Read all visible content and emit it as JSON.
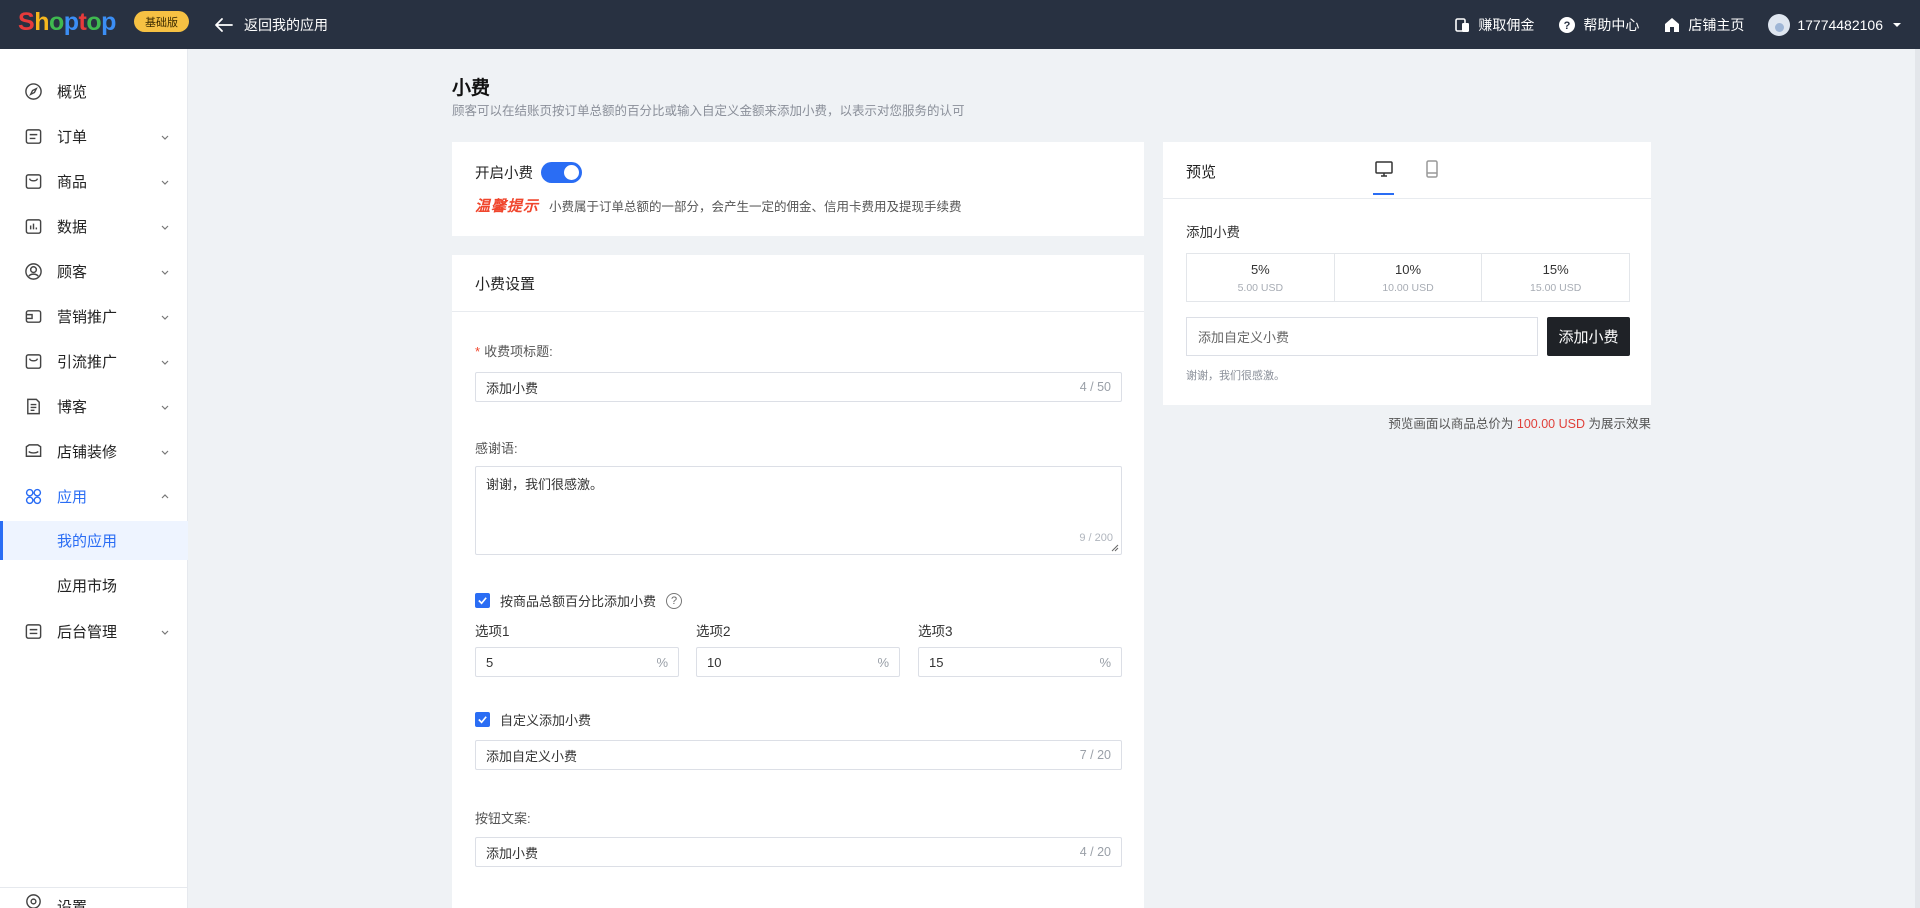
{
  "topbar": {
    "logo_letters": [
      "S",
      "h",
      "o",
      "p",
      "t",
      "o",
      "p"
    ],
    "plan_badge": "基础版",
    "back_label": "返回我的应用",
    "earn_label": "赚取佣金",
    "help_label": "帮助中心",
    "store_label": "店铺主页",
    "account_label": "17774482106"
  },
  "sidebar": {
    "items": [
      {
        "label": "概览",
        "icon": "compass-icon"
      },
      {
        "label": "订单",
        "icon": "order-icon"
      },
      {
        "label": "商品",
        "icon": "bag-icon"
      },
      {
        "label": "数据",
        "icon": "chart-icon"
      },
      {
        "label": "顾客",
        "icon": "user-icon"
      },
      {
        "label": "营销推广",
        "icon": "megaphone-icon"
      },
      {
        "label": "引流推广",
        "icon": "traffic-icon"
      },
      {
        "label": "博客",
        "icon": "blog-icon"
      },
      {
        "label": "店铺装修",
        "icon": "decor-icon"
      },
      {
        "label": "应用",
        "icon": "apps-icon"
      },
      {
        "label": "后台管理",
        "icon": "admin-icon"
      }
    ],
    "sub_items": [
      {
        "label": "我的应用"
      },
      {
        "label": "应用市场"
      }
    ],
    "bottom_label": "设置"
  },
  "page": {
    "title": "小费",
    "description": "顾客可以在结账页按订单总额的百分比或输入自定义金额来添加小费，以表示对您服务的认可"
  },
  "toggle_card": {
    "label": "开启小费",
    "enabled": true,
    "tip_label": "温馨提示",
    "tip_text": "小费属于订单总额的一部分，会产生一定的佣金、信用卡费用及提现手续费"
  },
  "settings": {
    "header": "小费设置",
    "title_field": {
      "label": "收费项标题:",
      "value": "添加小费",
      "counter": "4 / 50"
    },
    "thanks_field": {
      "label": "感谢语:",
      "value": "谢谢，我们很感激。",
      "counter": "9 / 200"
    },
    "percent_check": {
      "label": "按商品总额百分比添加小费",
      "checked": true,
      "help": "?"
    },
    "options": [
      {
        "label": "选项1",
        "value": "5",
        "suffix": "%"
      },
      {
        "label": "选项2",
        "value": "10",
        "suffix": "%"
      },
      {
        "label": "选项3",
        "value": "15",
        "suffix": "%"
      }
    ],
    "custom_check": {
      "label": "自定义添加小费",
      "checked": true
    },
    "custom_field": {
      "value": "添加自定义小费",
      "counter": "7 / 20"
    },
    "button_text_field": {
      "label": "按钮文案:",
      "value": "添加小费",
      "counter": "4 / 20"
    }
  },
  "preview": {
    "title": "预览",
    "section_label": "添加小费",
    "percent_options": [
      {
        "pct": "5%",
        "amount": "5.00 USD"
      },
      {
        "pct": "10%",
        "amount": "10.00 USD"
      },
      {
        "pct": "15%",
        "amount": "15.00 USD"
      }
    ],
    "custom_placeholder": "添加自定义小费",
    "button_label": "添加小费",
    "thanks": "谢谢，我们很感激。",
    "note_prefix": "预览画面以商品总价为",
    "note_amount": "100.00 USD",
    "note_suffix": "为展示效果"
  },
  "colors": {
    "topbar_bg": "#283141",
    "accent": "#2a6df4",
    "badge": "#f6c143",
    "tip_red": "#f0462d",
    "page_bg": "#eff2f5"
  }
}
